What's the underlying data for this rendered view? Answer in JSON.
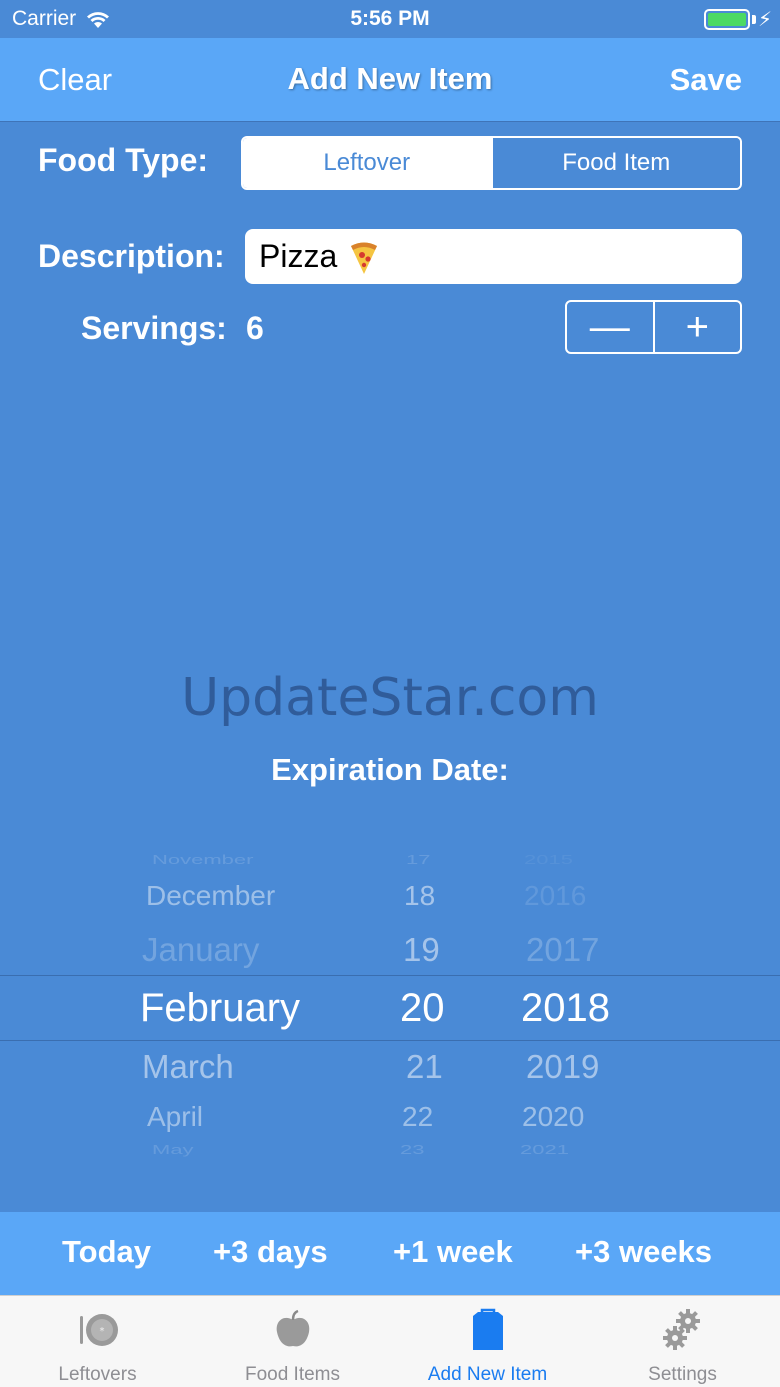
{
  "status_bar": {
    "carrier": "Carrier",
    "time": "5:56 PM"
  },
  "nav": {
    "left_label": "Clear",
    "title": "Add New Item",
    "right_label": "Save"
  },
  "form": {
    "food_type_label": "Food Type:",
    "food_type_options": [
      "Leftover",
      "Food Item"
    ],
    "food_type_selected": "Leftover",
    "description_label": "Description:",
    "description_value": "Pizza",
    "servings_label": "Servings:",
    "servings_value": "6",
    "stepper_minus": "—",
    "stepper_plus": "+"
  },
  "watermark": "UpdateStar.com",
  "expiration_label": "Expiration Date:",
  "picker": {
    "months": [
      "November",
      "December",
      "January",
      "February",
      "March",
      "April",
      "May"
    ],
    "days": [
      "17",
      "18",
      "19",
      "20",
      "21",
      "22",
      "23"
    ],
    "years": [
      "2015",
      "2016",
      "2017",
      "2018",
      "2019",
      "2020",
      "2021"
    ],
    "selected_month": "February",
    "selected_day": "20",
    "selected_year": "2018"
  },
  "quick_dates": [
    "Today",
    "+3 days",
    "+1 week",
    "+3 weeks"
  ],
  "tabs": [
    {
      "label": "Leftovers",
      "icon": "plate-icon"
    },
    {
      "label": "Food Items",
      "icon": "apple-icon"
    },
    {
      "label": "Add New Item",
      "icon": "bag-icon"
    },
    {
      "label": "Settings",
      "icon": "gears-icon"
    }
  ],
  "active_tab": "Add New Item",
  "colors": {
    "background": "#4a8ad6",
    "bar": "#5aa7f7",
    "tint": "#1a7cf0",
    "battery": "#4cd964"
  }
}
